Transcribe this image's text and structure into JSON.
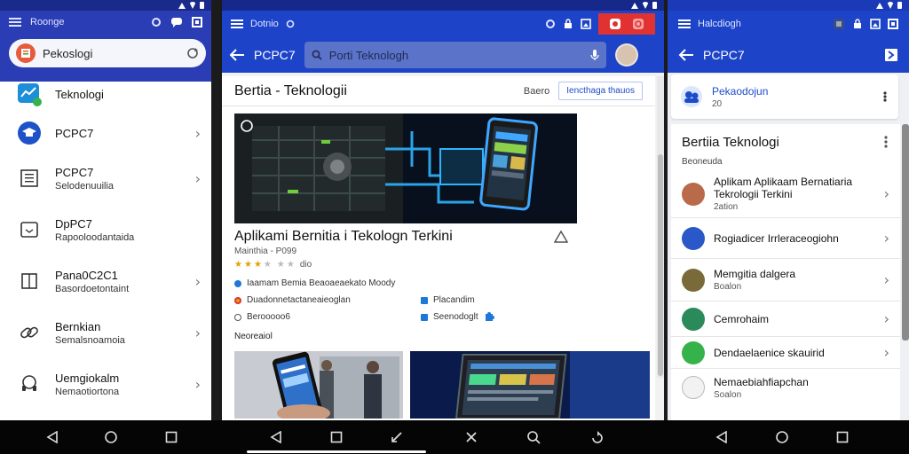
{
  "left_panel": {
    "topbar_title": "Roonge",
    "search_label": "Pekoslogi",
    "menu": [
      {
        "title": "Teknologi",
        "subtitle": ""
      },
      {
        "title": "PCPC7",
        "subtitle": ""
      },
      {
        "title": "PCPC7",
        "subtitle": "Selodenuuilia"
      },
      {
        "title": "DpPC7",
        "subtitle": "Rapooloodantaida"
      },
      {
        "title": "Pana0C2C1",
        "subtitle": "Basordoetontaint"
      },
      {
        "title": "Bernkian",
        "subtitle": "Semalsnoamoia"
      },
      {
        "title": "Uemgiokalm",
        "subtitle": "Nemaotiortona"
      }
    ]
  },
  "middle_panel": {
    "topbar_title": "Dotnio",
    "appbar_title": "PCPC7",
    "search_placeholder": "Porti Teknologh",
    "section_title": "Bertia - Teknologii",
    "section_small": "Baero",
    "section_button": "Iencthaga thauos",
    "article": {
      "title": "Aplikami Bernitia i Tekologn Terkini",
      "meta": "Mainthia - P099",
      "rating_text": "dio",
      "stars_filled": 3,
      "stars_total": 6,
      "row1": "Iaamam Bemia Beaoaeaekato Moody",
      "row2_left": "Duadonnetactaneaieoglan",
      "row2_right": "Placandim",
      "row3_left": "Berooooo6",
      "row3_right": "Seenodoglt"
    },
    "related_label": "Neoreaiol"
  },
  "right_panel": {
    "topbar_title": "Halcdiogh",
    "appbar_title": "PCPC7",
    "card1_title": "Pekaodojun",
    "card1_sub": "20",
    "card2_title": "Bertiia Teknologi",
    "card2_sub": "Beoneuda",
    "items": [
      {
        "title": "Aplikam Aplikaam Bernatiaria Tekrologii Terkini",
        "subtitle": "2ation"
      },
      {
        "title": "Rogiadicer Irrleraceogiohn",
        "subtitle": ""
      },
      {
        "title": "Memgitia dalgera",
        "subtitle": "Boalon"
      },
      {
        "title": "Cemrohaim",
        "subtitle": ""
      },
      {
        "title": "Dendaelaenice skauirid",
        "subtitle": ""
      },
      {
        "title": "Nemaebiahfiapchan",
        "subtitle": "Soalon"
      }
    ]
  },
  "colors": {
    "brand_blue": "#1d44c8",
    "status_red": "#e13232"
  }
}
